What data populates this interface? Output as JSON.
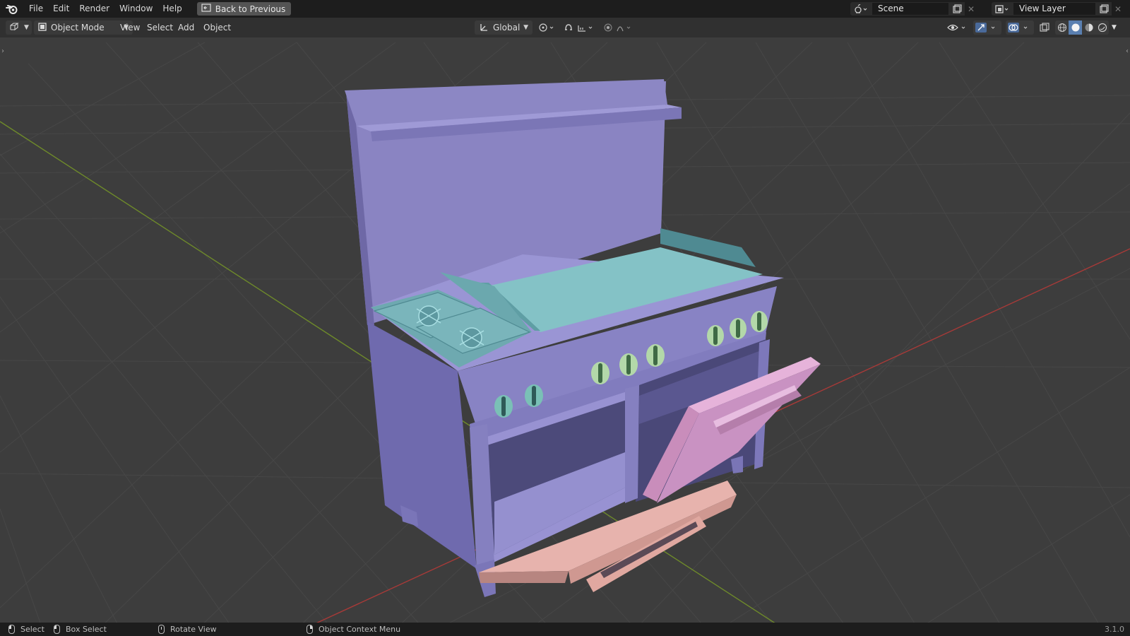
{
  "topbar": {
    "menus": [
      "File",
      "Edit",
      "Render",
      "Window",
      "Help"
    ],
    "back_label": "Back to Previous",
    "scene_name": "Scene",
    "view_layer_name": "View Layer"
  },
  "header": {
    "mode_label": "Object Mode",
    "menus": [
      "View",
      "Select",
      "Add",
      "Object"
    ],
    "transform_orientation": "Global"
  },
  "status": {
    "select": "Select",
    "box_select": "Box Select",
    "rotate_view": "Rotate View",
    "context_menu": "Object Context Menu",
    "version": "3.1.0"
  },
  "icons": {
    "logo": "blender-logo-icon",
    "editor_type": "3d-viewport-icon",
    "visibility": "eye-icon",
    "gizmo": "gizmo-icon",
    "overlay": "overlay-icon",
    "xray": "xray-icon",
    "shading_modes": [
      "wireframe-icon",
      "solid-icon",
      "material-preview-icon",
      "rendered-icon"
    ]
  },
  "colors": {
    "accent": "#5a7fb0",
    "x_axis": "#b8413e",
    "y_axis": "#7a9a2c",
    "body": "#8b86c6",
    "cooktop": "#7fbdc2",
    "door": "#d38fbc",
    "lower_door": "#dca09a",
    "knob": "#9fd0b0"
  }
}
